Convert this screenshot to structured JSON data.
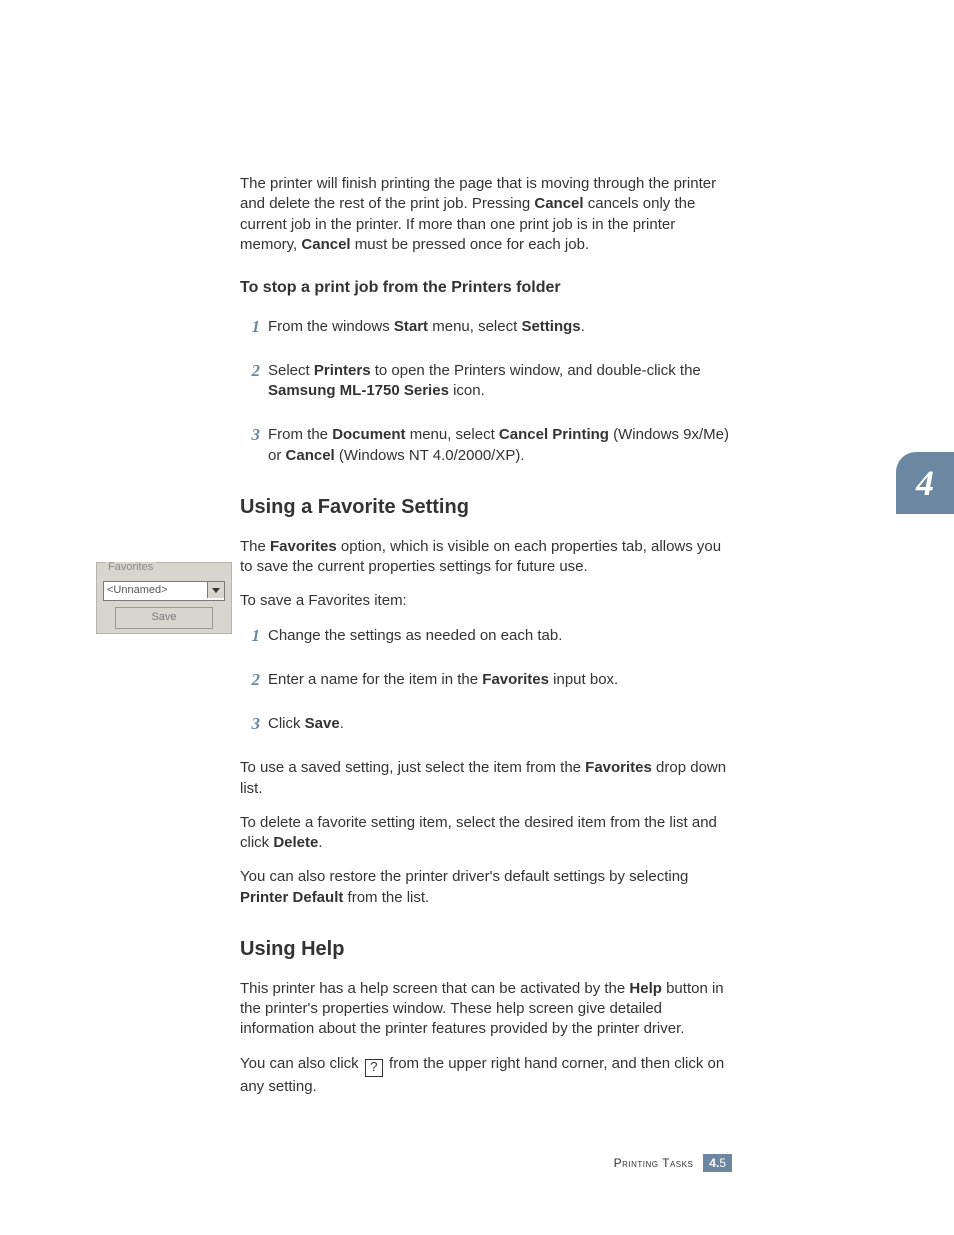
{
  "chapter_tab": "4",
  "intro": {
    "p1_a": "The printer will finish printing the page that is moving through the printer and delete the rest of the print job. Pressing ",
    "p1_b": "Cancel",
    "p1_c": " cancels only the current job in the printer. If more than one print job is in the printer memory, ",
    "p1_d": "Cancel",
    "p1_e": " must be pressed once for each job."
  },
  "stop_head": "To stop a print job from the Printers folder",
  "stop_steps": {
    "s1": {
      "num": "1",
      "a": "From the windows ",
      "b": "Start",
      "c": " menu, select ",
      "d": "Settings",
      "e": "."
    },
    "s2": {
      "num": "2",
      "a": "Select ",
      "b": "Printers",
      "c": " to open the Printers window, and double-click the ",
      "d": "Samsung ML-1750 Series",
      "e": " icon."
    },
    "s3": {
      "num": "3",
      "a": "From the ",
      "b": "Document",
      "c": " menu, select ",
      "d": "Cancel Printing",
      "e": " (Windows 9x/Me) or ",
      "f": "Cancel",
      "g": " (Windows NT 4.0/2000/XP)."
    }
  },
  "fav_head": "Using a Favorite Setting",
  "fav_intro": {
    "a": "The ",
    "b": "Favorites",
    "c": " option, which is visible on each properties tab, allows you to save the current properties settings for future use."
  },
  "fav_to_save": "To save a Favorites item:",
  "fav_steps": {
    "s1": {
      "num": "1",
      "a": "Change the settings as needed on each tab."
    },
    "s2": {
      "num": "2",
      "a": "Enter a name for the item in the ",
      "b": "Favorites",
      "c": " input box."
    },
    "s3": {
      "num": "3",
      "a": "Click ",
      "b": "Save",
      "c": "."
    }
  },
  "fav_use": {
    "a": "To use a saved setting, just select the item from the ",
    "b": "Favorites",
    "c": " drop down list."
  },
  "fav_delete": {
    "a": "To delete a favorite setting item, select the desired item from the list and click ",
    "b": "Delete",
    "c": "."
  },
  "fav_restore": {
    "a": "You can also restore the printer driver's default settings by selecting ",
    "b": "Printer Default",
    "c": " from the list."
  },
  "help_head": "Using Help",
  "help_p1": {
    "a": "This printer has a help screen that can be activated by the ",
    "b": "Help",
    "c": " button in the printer's properties window. These help screen give detailed information about the printer features provided by the printer driver."
  },
  "help_p2": {
    "a": "You can also click ",
    "q": "?",
    "b": " from the upper right hand corner, and then click on any setting."
  },
  "widget": {
    "group_label": "Favorites",
    "dropdown_value": "<Unnamed>",
    "save_label": "Save"
  },
  "footer": {
    "title": "Printing Tasks",
    "chapter": "4.",
    "page": "5"
  }
}
